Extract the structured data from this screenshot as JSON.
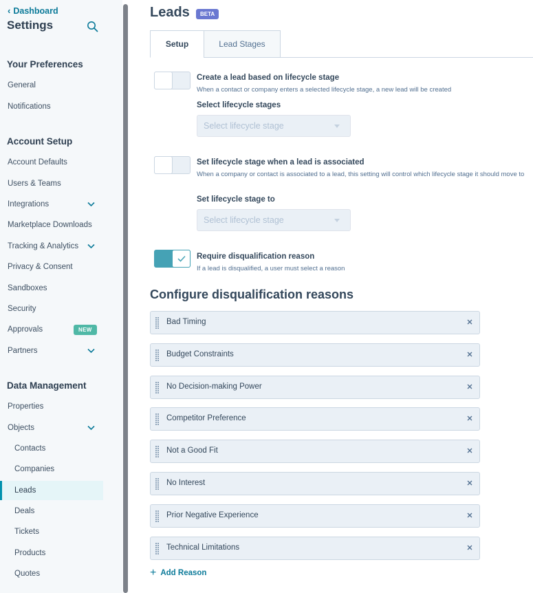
{
  "sidebar": {
    "back_label": "Dashboard",
    "title": "Settings",
    "sections": {
      "preferences": "Your Preferences",
      "account_setup": "Account Setup",
      "data_management": "Data Management"
    },
    "items": {
      "general": "General",
      "notifications": "Notifications",
      "account_defaults": "Account Defaults",
      "users_teams": "Users & Teams",
      "integrations": "Integrations",
      "marketplace_downloads": "Marketplace Downloads",
      "tracking_analytics": "Tracking & Analytics",
      "privacy_consent": "Privacy & Consent",
      "sandboxes": "Sandboxes",
      "security": "Security",
      "approvals": "Approvals",
      "partners": "Partners",
      "properties": "Properties",
      "objects": "Objects",
      "contacts": "Contacts",
      "companies": "Companies",
      "leads": "Leads",
      "deals": "Deals",
      "tickets": "Tickets",
      "products": "Products",
      "quotes": "Quotes"
    },
    "new_badge": "NEW",
    "active_item": "leads"
  },
  "header": {
    "title": "Leads",
    "badge": "BETA"
  },
  "tabs": [
    "Setup",
    "Lead Stages"
  ],
  "active_tab": "Setup",
  "settings": {
    "lifecycle_lead": {
      "label": "Create a lead based on lifecycle stage",
      "description": "When a contact or company enters a selected lifecycle stage, a new lead will be created",
      "enabled": false,
      "field_label": "Select lifecycle stages",
      "placeholder": "Select lifecycle stage"
    },
    "lifecycle_on_associate": {
      "label": "Set lifecycle stage when a lead is associated",
      "description": "When a company or contact is associated to a lead, this setting will control which lifecycle stage it should move to",
      "enabled": false,
      "field_label": "Set lifecycle stage to",
      "placeholder": "Select lifecycle stage"
    },
    "disqualification": {
      "label": "Require disqualification reason",
      "description": "If a lead is disqualified, a user must select a reason",
      "enabled": true
    }
  },
  "reasons_section": {
    "heading": "Configure disqualification reasons",
    "reasons": [
      "Bad Timing",
      "Budget Constraints",
      "No Decision-making Power",
      "Competitor Preference",
      "Not a Good Fit",
      "No Interest",
      "Prior Negative Experience",
      "Technical Limitations"
    ],
    "add_label": "Add Reason"
  },
  "colors": {
    "link": "#0b7a99",
    "toggle_on": "#45a2b5",
    "beta_badge": "#6a78d1",
    "new_badge": "#4fb8a6"
  }
}
